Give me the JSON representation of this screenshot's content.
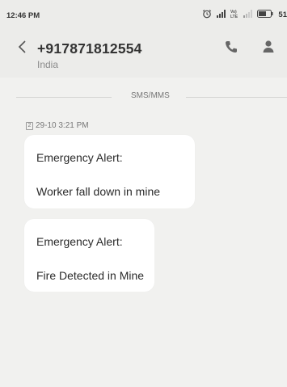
{
  "status_bar": {
    "time": "12:46 PM",
    "battery": "51",
    "icons": [
      "alarm-icon",
      "signal-icon",
      "volte-icon",
      "signal-weak-icon",
      "battery-icon"
    ]
  },
  "header": {
    "contact_number": "+917871812554",
    "contact_subtitle": "India",
    "icons": [
      "back-arrow-icon",
      "phone-icon",
      "person-icon"
    ]
  },
  "conversation": {
    "divider_label": "SMS/MMS",
    "timestamp": "29-10 3:21 PM",
    "sim_label": "2",
    "messages": [
      {
        "title": "Emergency Alert:",
        "body": "Worker fall down in mine"
      },
      {
        "title": "Emergency Alert:",
        "body": "Fire Detected in Mine"
      }
    ]
  }
}
